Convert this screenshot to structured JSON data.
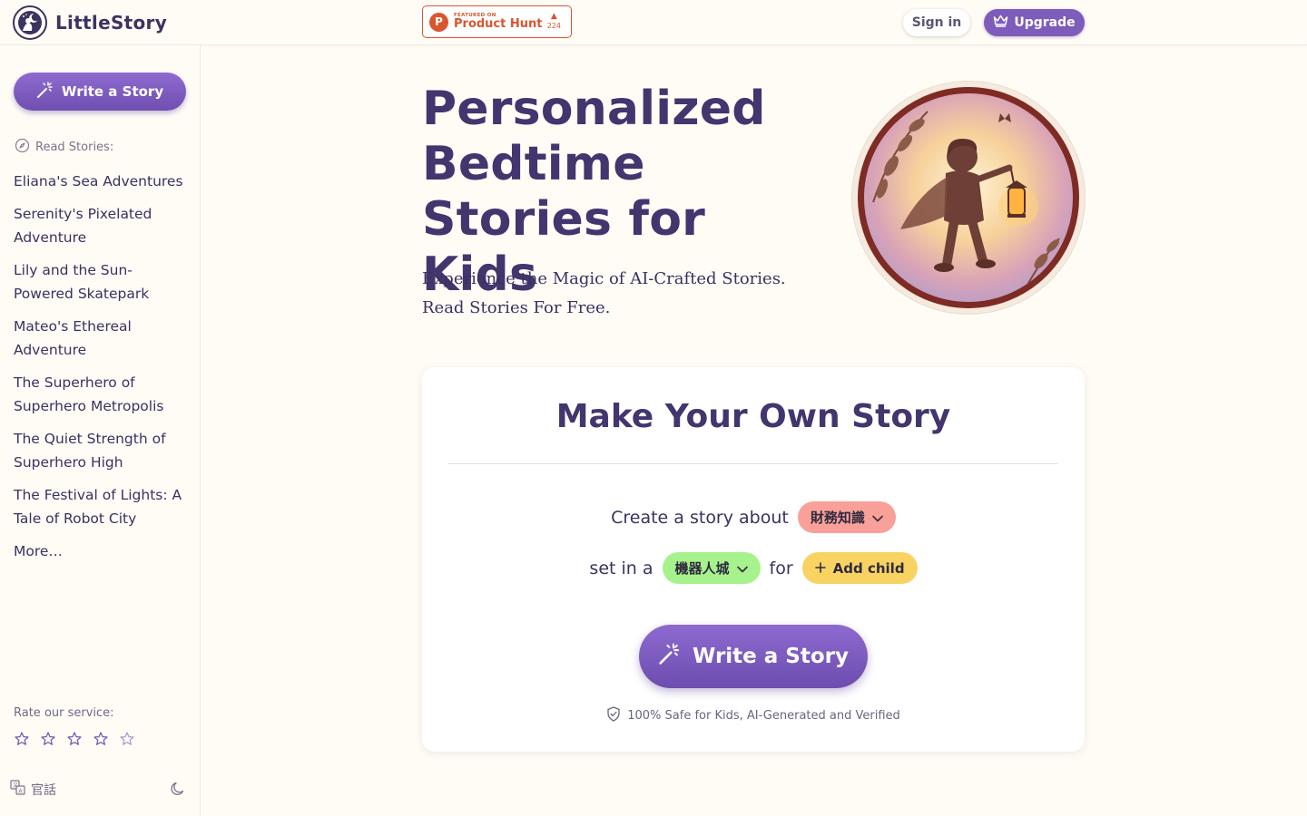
{
  "header": {
    "brand": "LittleStory",
    "product_hunt": {
      "featured_label": "FEATURED ON",
      "name": "Product Hunt",
      "letter": "P",
      "votes": "224"
    },
    "signin_label": "Sign in",
    "upgrade_label": "Upgrade"
  },
  "sidebar": {
    "write_label": "Write a Story",
    "read_heading": "Read Stories:",
    "stories": [
      "Eliana's Sea Adventures",
      "Serenity's Pixelated Adventure",
      "Lily and the Sun-Powered Skatepark",
      "Mateo's Ethereal Adventure",
      "The Superhero of Superhero Metropolis",
      "The Quiet Strength of Superhero High",
      "The Festival of Lights: A Tale of Robot City",
      "More…"
    ],
    "rate_label": "Rate our service:",
    "rating_stars": 5,
    "language_label": "官話"
  },
  "hero": {
    "title": "Personalized Bedtime Stories for Kids",
    "subtitle": "Experience the Magic of AI-Crafted Stories. Read Stories For Free."
  },
  "card": {
    "title": "Make Your Own Story",
    "row1_prefix": "Create a story about",
    "topic_value": "財務知識",
    "row2_prefix": "set in a",
    "setting_value": "機器人城",
    "row2_for": "for",
    "add_child_label": "Add child",
    "write_label": "Write a Story",
    "safety_note": "100% Safe for Kids, AI-Generated and Verified"
  },
  "colors": {
    "brand_purple": "#7d5cbb",
    "title_purple": "#43356e",
    "topic_pill": "#f9a198",
    "setting_pill": "#a6f28c",
    "child_pill": "#f8d362",
    "product_hunt": "#da552f"
  }
}
